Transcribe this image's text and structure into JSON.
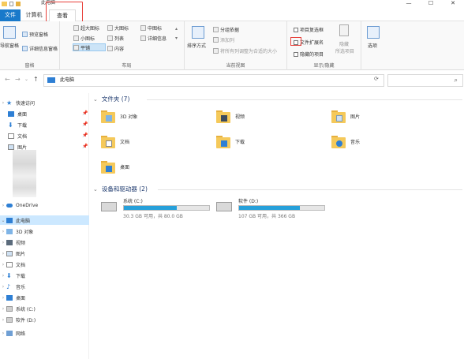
{
  "window": {
    "title": "此电脑",
    "minimize": "—",
    "maximize": "☐",
    "close": "✕"
  },
  "tabs": {
    "file": "文件",
    "computer": "计算机",
    "view": "查看"
  },
  "ribbon": {
    "panes": {
      "nav_pane": "导航窗格",
      "preview": "预览窗格",
      "details": "详细信息窗格",
      "label": "窗格"
    },
    "layout": {
      "items": [
        "超大图标",
        "大图标",
        "中图标",
        "小图标",
        "列表",
        "详细信息",
        "平铺",
        "内容"
      ],
      "label": "布局"
    },
    "current_view": {
      "sort": "排序方式",
      "group": "分组依据",
      "add_column": "添加列",
      "fit_columns": "将所有列调整为合适的大小",
      "label": "当前视图"
    },
    "show_hide": {
      "item_checkboxes": "项目复选框",
      "file_ext": "文件扩展名",
      "hidden_items": "隐藏的项目",
      "hide_selected": "隐藏",
      "hide_selected_sub": "所选项目",
      "label": "显示/隐藏"
    },
    "options": "选项"
  },
  "address": {
    "path": "此电脑",
    "back": "←",
    "forward": "→",
    "recent": "⌄",
    "up": "↑",
    "refresh": "⟳",
    "search_icon": "⌕"
  },
  "nav": {
    "items": [
      {
        "label": "快速访问",
        "chevron": "›"
      },
      {
        "label": "桌面",
        "pinned": true
      },
      {
        "label": "下载",
        "pinned": true
      },
      {
        "label": "文档",
        "pinned": true
      },
      {
        "label": "图片",
        "pinned": true
      },
      {
        "label": "OneDrive",
        "chevron": "›"
      },
      {
        "label": "此电脑",
        "chevron": "⌄"
      },
      {
        "label": "3D 对象",
        "chevron": "›"
      },
      {
        "label": "视频",
        "chevron": "›"
      },
      {
        "label": "图片",
        "chevron": "›"
      },
      {
        "label": "文档",
        "chevron": "›"
      },
      {
        "label": "下载",
        "chevron": "›"
      },
      {
        "label": "音乐",
        "chevron": "›"
      },
      {
        "label": "桌面",
        "chevron": "›"
      },
      {
        "label": "系统 (C:)",
        "chevron": "›"
      },
      {
        "label": "软件 (D:)",
        "chevron": "›"
      },
      {
        "label": "网络",
        "chevron": "›"
      }
    ],
    "pin": "📌"
  },
  "main": {
    "folders_header": "文件夹 (7)",
    "folders": [
      {
        "name": "3D 对象"
      },
      {
        "name": "视频"
      },
      {
        "name": "图片"
      },
      {
        "name": "文档"
      },
      {
        "name": "下载"
      },
      {
        "name": "音乐"
      },
      {
        "name": "桌面"
      }
    ],
    "drives_header": "设备和驱动器 (2)",
    "drives": [
      {
        "name": "系统 (C:)",
        "size": "30.3 GB 可用，共 80.0 GB",
        "used_fraction": 0.62
      },
      {
        "name": "软件 (D:)",
        "size": "107 GB 可用，共 366 GB",
        "used_fraction": 0.71
      }
    ]
  },
  "colors": {
    "accent": "#1979ca",
    "highlight": "#e8403a",
    "selected": "#cce8ff",
    "folder": "#f5c95a",
    "drive_fill": "#26a0da"
  }
}
